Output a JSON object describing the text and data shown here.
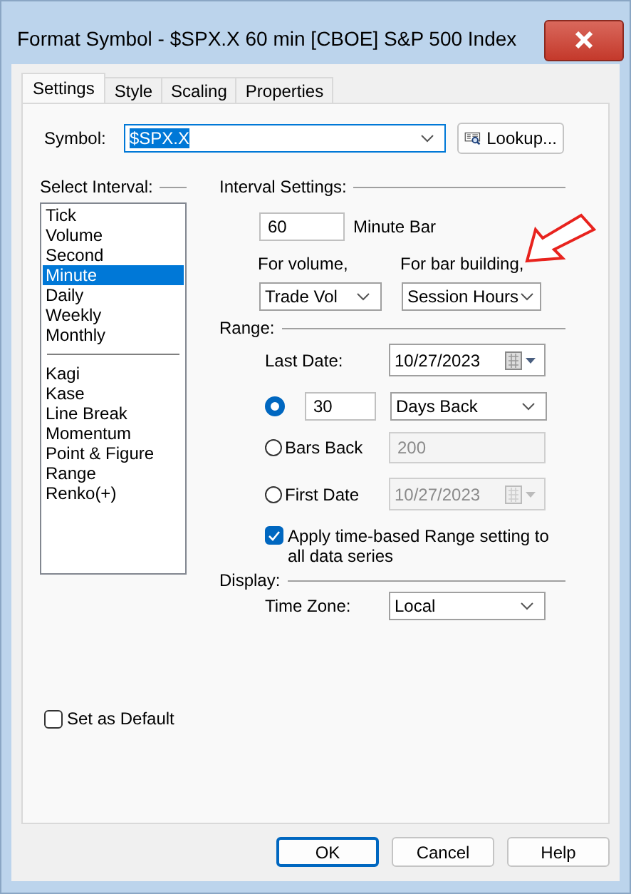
{
  "window": {
    "title": "Format Symbol - $SPX.X 60 min [CBOE] S&P 500 Index"
  },
  "tabs": [
    {
      "label": "Settings",
      "selected": true
    },
    {
      "label": "Style",
      "selected": false
    },
    {
      "label": "Scaling",
      "selected": false
    },
    {
      "label": "Properties",
      "selected": false
    }
  ],
  "symbol": {
    "label": "Symbol:",
    "value": "$SPX.X",
    "lookup_button": "Lookup..."
  },
  "interval_list": {
    "label": "Select Interval:",
    "groups": [
      {
        "items": [
          {
            "label": "Tick",
            "selected": false
          },
          {
            "label": "Volume",
            "selected": false
          },
          {
            "label": "Second",
            "selected": false
          },
          {
            "label": "Minute",
            "selected": true
          },
          {
            "label": "Daily",
            "selected": false
          },
          {
            "label": "Weekly",
            "selected": false
          },
          {
            "label": "Monthly",
            "selected": false
          }
        ]
      },
      {
        "items": [
          {
            "label": "Kagi",
            "selected": false
          },
          {
            "label": "Kase",
            "selected": false
          },
          {
            "label": "Line Break",
            "selected": false
          },
          {
            "label": "Momentum",
            "selected": false
          },
          {
            "label": "Point & Figure",
            "selected": false
          },
          {
            "label": "Range",
            "selected": false
          },
          {
            "label": "Renko(+)",
            "selected": false
          }
        ]
      }
    ]
  },
  "interval_settings": {
    "heading": "Interval Settings:",
    "bar_size": "60",
    "bar_unit": "Minute Bar",
    "volume": {
      "label": "For volume,",
      "value": "Trade Vol"
    },
    "bar_building": {
      "label": "For bar building,",
      "value": "Session Hours"
    }
  },
  "range": {
    "heading": "Range:",
    "last_date": {
      "label": "Last Date:",
      "value": "10/27/2023"
    },
    "options": [
      {
        "kind": "days",
        "selected": true,
        "value": "30",
        "unit": "Days Back",
        "disabled": false
      },
      {
        "kind": "bars",
        "label": "Bars Back",
        "selected": false,
        "value": "200",
        "disabled": true
      },
      {
        "kind": "date",
        "label": "First Date",
        "selected": false,
        "value": "10/27/2023",
        "disabled": true
      }
    ],
    "apply_all": {
      "label": "Apply time-based Range setting to all data series",
      "checked": true
    }
  },
  "display": {
    "heading": "Display:",
    "time_zone": {
      "label": "Time Zone:",
      "value": "Local"
    }
  },
  "set_default": {
    "label": "Set as Default",
    "checked": false
  },
  "buttons": [
    {
      "label": "OK",
      "default": true
    },
    {
      "label": "Cancel",
      "default": false
    },
    {
      "label": "Help",
      "default": false
    }
  ]
}
